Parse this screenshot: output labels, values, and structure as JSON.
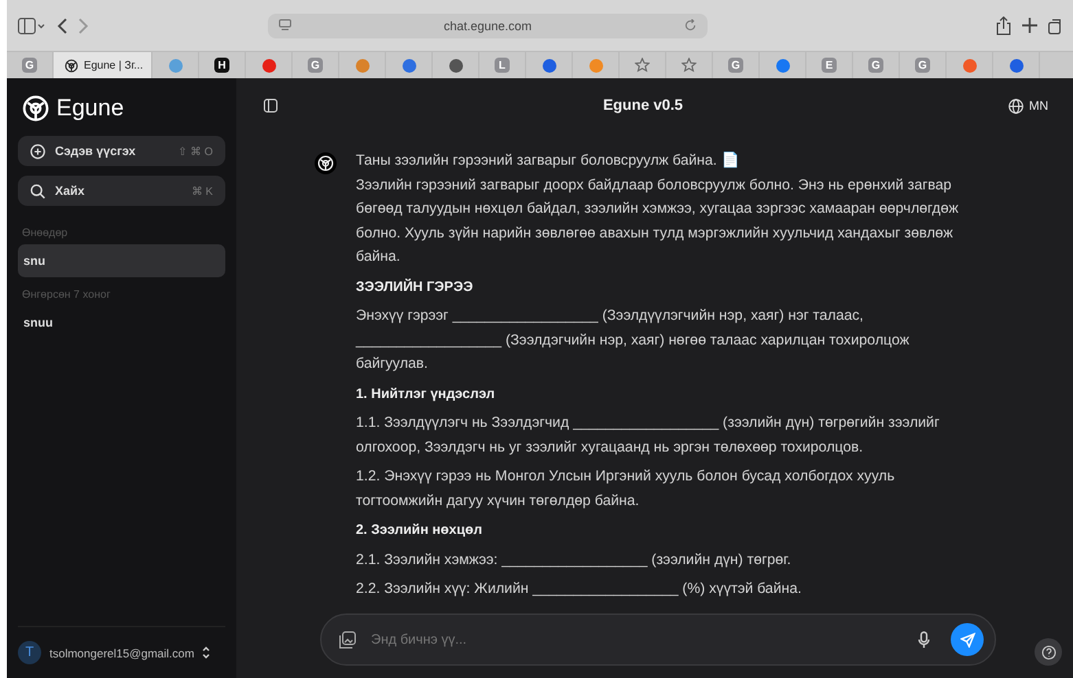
{
  "browser": {
    "url": "chat.egune.com",
    "tabs": [
      {
        "kind": "letter",
        "letter": "G",
        "color": "#8e8e93",
        "selected": false
      },
      {
        "kind": "logo",
        "label": "Egune | Зг...",
        "color": "#222222",
        "selected": true
      },
      {
        "kind": "dot",
        "color": "#5aa0d8",
        "selected": false
      },
      {
        "kind": "letter",
        "letter": "H",
        "color": "#111111",
        "selected": false
      },
      {
        "kind": "dot",
        "color": "#e62117",
        "selected": false
      },
      {
        "kind": "letter",
        "letter": "G",
        "color": "#8e8e93",
        "selected": false
      },
      {
        "kind": "dot",
        "color": "#d9822b",
        "selected": false
      },
      {
        "kind": "dot",
        "color": "#2f6fe0",
        "selected": false
      },
      {
        "kind": "dot",
        "color": "#555555",
        "selected": false
      },
      {
        "kind": "letter",
        "letter": "L",
        "color": "#8e8e93",
        "selected": false
      },
      {
        "kind": "dot",
        "color": "#1f5fe0",
        "selected": false
      },
      {
        "kind": "dot",
        "color": "#f08a24",
        "selected": false
      },
      {
        "kind": "star",
        "color": "#666666",
        "selected": false
      },
      {
        "kind": "star",
        "color": "#666666",
        "selected": false
      },
      {
        "kind": "letter",
        "letter": "G",
        "color": "#8e8e93",
        "selected": false
      },
      {
        "kind": "dot",
        "color": "#1877f2",
        "selected": false
      },
      {
        "kind": "letter",
        "letter": "E",
        "color": "#8e8e93",
        "selected": false
      },
      {
        "kind": "letter",
        "letter": "G",
        "color": "#8e8e93",
        "selected": false
      },
      {
        "kind": "letter",
        "letter": "G",
        "color": "#8e8e93",
        "selected": false
      },
      {
        "kind": "dot",
        "color": "#f05a28",
        "selected": false
      },
      {
        "kind": "dot",
        "color": "#1f5fe0",
        "selected": false
      }
    ]
  },
  "sidebar": {
    "brand": "Egune",
    "actions": [
      {
        "kind": "new",
        "label": "Сэдэв үүсгэх",
        "shortcut": "⇧ ⌘ O"
      },
      {
        "kind": "search",
        "label": "Хайх",
        "shortcut": "⌘ K"
      }
    ],
    "groups": [
      {
        "title": "Өнөөдөр",
        "items": [
          {
            "label": "snu",
            "selected": true
          }
        ]
      },
      {
        "title": "Өнгөрсөн 7 хоног",
        "items": [
          {
            "label": "snuu",
            "selected": false
          }
        ]
      }
    ],
    "user": {
      "initial": "T",
      "email": "tsolmongerel15@gmail.com"
    }
  },
  "header": {
    "title": "Egune v0.5",
    "language": "MN"
  },
  "message": {
    "blocks": [
      {
        "kind": "para",
        "text": "Таны зээлийн гэрээний загварыг боловсруулж байна. 📄"
      },
      {
        "kind": "para",
        "text": "Зээлийн гэрээний загварыг доорх байдлаар боловсруулж болно. Энэ нь ерөнхий загвар бөгөөд талуудын нөхцөл байдал, зээлийн хэмжээ, хугацаа зэргээс хамааран өөрчлөгдөж болно. Хууль зүйн нарийн зөвлөгөө авахын тулд мэргэжлийн хуульчид хандахыг зөвлөж байна."
      },
      {
        "kind": "heading",
        "text": "ЗЭЭЛИЙН ГЭРЭЭ"
      },
      {
        "kind": "para",
        "text": "Энэхүү гэрээг __________________ (Зээлдүүлэгчийн нэр, хаяг) нэг талаас, __________________ (Зээлдэгчийн нэр, хаяг) нөгөө талаас харилцан тохиролцож байгуулав."
      },
      {
        "kind": "heading",
        "text": "1. Нийтлэг үндэслэл"
      },
      {
        "kind": "para",
        "text": "1.1. Зээлдүүлэгч нь Зээлдэгчид __________________ (зээлийн дүн) төгрөгийн зээлийг олгохоор, Зээлдэгч нь уг зээлийг хугацаанд нь эргэн төлөхөөр тохиролцов."
      },
      {
        "kind": "para",
        "text": "1.2. Энэхүү гэрээ нь Монгол Улсын Иргэний хууль болон бусад холбогдох хууль тогтоомжийн дагуу хүчин төгөлдөр байна."
      },
      {
        "kind": "heading",
        "text": "2. Зээлийн нөхцөл"
      },
      {
        "kind": "para",
        "text": "2.1. Зээлийн хэмжээ: __________________ (зээлийн дүн) төгрөг."
      },
      {
        "kind": "para",
        "text": "2.2. Зээлийн хүү: Жилийн __________________ (%) хүүтэй байна."
      }
    ]
  },
  "composer": {
    "placeholder": "Энд бичнэ үү..."
  }
}
